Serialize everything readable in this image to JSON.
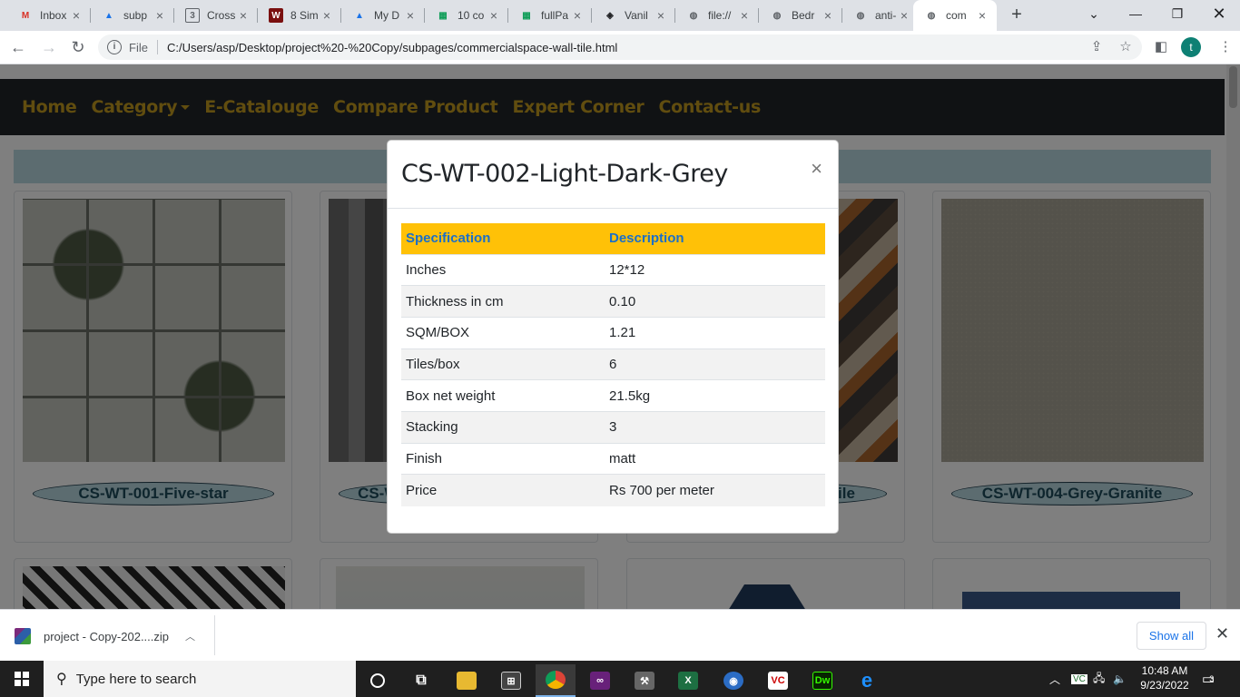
{
  "browser": {
    "tabs": [
      {
        "title": "Inbox",
        "favicon": "gmail-icon",
        "color": "#d93025",
        "glyph": "M"
      },
      {
        "title": "subp",
        "favicon": "drive-icon",
        "color": "#1a73e8",
        "glyph": "▲"
      },
      {
        "title": "Cross",
        "favicon": "css-icon",
        "color": "#5f6368",
        "glyph": "3"
      },
      {
        "title": "8 Sim",
        "favicon": "w-logo-icon",
        "color": "#7a0f0f",
        "glyph": "W"
      },
      {
        "title": "My D",
        "favicon": "drive-icon",
        "color": "#1a73e8",
        "glyph": "▲"
      },
      {
        "title": "10 co",
        "favicon": "sheets-icon",
        "color": "#0f9d58",
        "glyph": "▦"
      },
      {
        "title": "fullPa",
        "favicon": "sheets-icon",
        "color": "#0f9d58",
        "glyph": "▦"
      },
      {
        "title": "Vanil",
        "favicon": "codepen-icon",
        "color": "#202124",
        "glyph": "◈"
      },
      {
        "title": "file://",
        "favicon": "globe-icon",
        "color": "#5f6368",
        "glyph": "◍"
      },
      {
        "title": "Bedr",
        "favicon": "globe-icon",
        "color": "#5f6368",
        "glyph": "◍"
      },
      {
        "title": "anti-",
        "favicon": "globe-icon",
        "color": "#5f6368",
        "glyph": "◍"
      },
      {
        "title": "com",
        "favicon": "globe-icon",
        "color": "#5f6368",
        "glyph": "◍"
      }
    ],
    "address": {
      "scheme_label": "File",
      "url": "C:/Users/asp/Desktop/project%20-%20Copy/subpages/commercialspace-wall-tile.html"
    },
    "profile_initial": "t"
  },
  "site": {
    "nav": {
      "home": "Home",
      "category": "Category",
      "catalogue": "E-Catalouge",
      "compare": "Compare Product",
      "expert": "Expert Corner",
      "contact": "Contact-us"
    },
    "cards": [
      {
        "caption": "CS-WT-001-Five-star"
      },
      {
        "caption": "CS-WT-002-Light-Dark-Grey"
      },
      {
        "caption": "CS-WT-003-Wooden-Tile"
      },
      {
        "caption": "CS-WT-004-Grey-Granite"
      }
    ]
  },
  "modal": {
    "title": "CS-WT-002-Light-Dark-Grey",
    "close_symbol": "×",
    "columns": [
      "Specification",
      "Description"
    ],
    "rows": [
      [
        "Inches",
        "12*12"
      ],
      [
        "Thickness in cm",
        "0.10"
      ],
      [
        "SQM/BOX",
        "1.21"
      ],
      [
        "Tiles/box",
        "6"
      ],
      [
        "Box net weight",
        "21.5kg"
      ],
      [
        "Stacking",
        "3"
      ],
      [
        "Finish",
        "matt"
      ],
      [
        "Price",
        "Rs 700 per meter"
      ]
    ]
  },
  "downloads": {
    "file": "project - Copy-202....zip",
    "show_all": "Show all"
  },
  "taskbar": {
    "search_placeholder": "Type here to search",
    "time": "10:48 AM",
    "date": "9/23/2022",
    "notification_count": "3"
  },
  "colors": {
    "nav_bg": "#212529",
    "nav_text": "#c39a1e",
    "table_header_bg": "#ffc107",
    "table_header_text": "#1b6fc8",
    "caption_bg": "#b8d8e0"
  }
}
